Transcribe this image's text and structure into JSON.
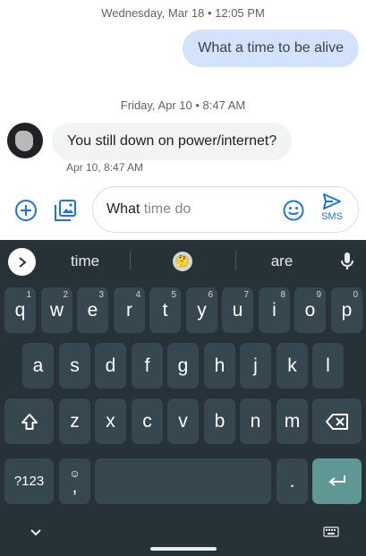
{
  "conversation": {
    "date_separator_1": "Wednesday, Mar 18 • 12:05 PM",
    "outgoing_message": "What a time to be alive",
    "date_separator_2": "Friday, Apr 10 • 8:47 AM",
    "incoming_message": "You still down on power/internet?",
    "incoming_time": "Apr 10, 8:47 AM"
  },
  "compose": {
    "typed_text": "What",
    "suggested_completion": " time do",
    "send_label": "SMS",
    "icons": [
      "add-icon",
      "gallery-icon",
      "emoji-icon",
      "send-icon"
    ]
  },
  "keyboard": {
    "suggestions": [
      "time",
      "are"
    ],
    "suggestion_emoji": "🤔",
    "row1": [
      {
        "key": "q",
        "hint": "1"
      },
      {
        "key": "w",
        "hint": "2"
      },
      {
        "key": "e",
        "hint": "3"
      },
      {
        "key": "r",
        "hint": "4"
      },
      {
        "key": "t",
        "hint": "5"
      },
      {
        "key": "y",
        "hint": "6"
      },
      {
        "key": "u",
        "hint": "7"
      },
      {
        "key": "i",
        "hint": "8"
      },
      {
        "key": "o",
        "hint": "9"
      },
      {
        "key": "p",
        "hint": "0"
      }
    ],
    "row2": [
      "a",
      "s",
      "d",
      "f",
      "g",
      "h",
      "j",
      "k",
      "l"
    ],
    "row3": [
      "z",
      "x",
      "c",
      "v",
      "b",
      "n",
      "m"
    ],
    "symbols_key": "?123",
    "comma_key": ",",
    "period_key": ".",
    "accent_color": "#5e9793"
  }
}
